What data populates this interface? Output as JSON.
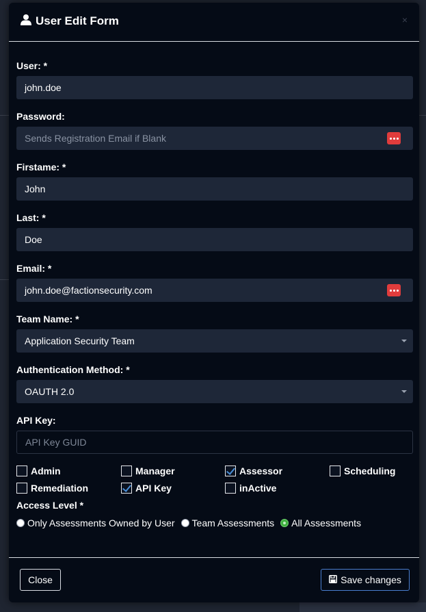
{
  "modal": {
    "title": "User Edit Form",
    "close_glyph": "×"
  },
  "form": {
    "user_label": "User: *",
    "user_value": "john.doe",
    "password_label": "Password:",
    "password_placeholder": "Sends Registration Email if Blank",
    "firstname_label": "Firstame: *",
    "firstname_value": "John",
    "last_label": "Last: *",
    "last_value": "Doe",
    "email_label": "Email: *",
    "email_value": "john.doe@factionsecurity.com",
    "team_label": "Team Name: *",
    "team_value": "Application Security Team",
    "auth_label": "Authentication Method: *",
    "auth_value": "OAUTH 2.0",
    "apikey_label": "API Key:",
    "apikey_placeholder": "API Key GUID"
  },
  "roles": [
    {
      "label": "Admin",
      "checked": false
    },
    {
      "label": "Manager",
      "checked": false
    },
    {
      "label": "Assessor",
      "checked": true
    },
    {
      "label": "Scheduling",
      "checked": false
    },
    {
      "label": "Remediation",
      "checked": false
    },
    {
      "label": "API Key",
      "checked": true
    },
    {
      "label": "inActive",
      "checked": false
    }
  ],
  "access": {
    "label": "Access Level *",
    "options": [
      {
        "label": "Only Assessments Owned by User",
        "selected": false
      },
      {
        "label": "Team Assessments",
        "selected": false
      },
      {
        "label": "All Assessments",
        "selected": true
      }
    ]
  },
  "footer": {
    "close_label": "Close",
    "save_label": "Save changes"
  },
  "colors": {
    "modal_bg": "#050b16",
    "field_bg": "#1e2738",
    "accent": "#4a7fd1",
    "password_manager_icon": "#e03c3c"
  }
}
